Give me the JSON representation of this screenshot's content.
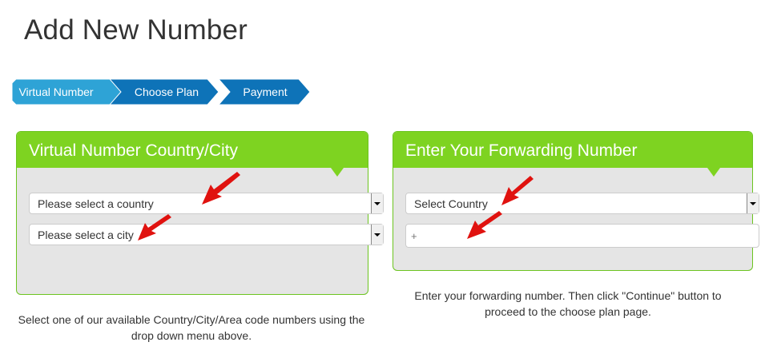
{
  "page": {
    "title": "Add New Number"
  },
  "steps": [
    {
      "label": "Virtual Number",
      "color": "#2ea3d6"
    },
    {
      "label": "Choose Plan",
      "color": "#0e73b8"
    },
    {
      "label": "Payment",
      "color": "#0e73b8"
    }
  ],
  "panel_left": {
    "title": "Virtual Number Country/City",
    "country_select": {
      "value": "Please select a country"
    },
    "city_select": {
      "value": "Please select a city"
    },
    "help": "Select one of our available Country/City/Area code numbers using the drop down menu above."
  },
  "panel_right": {
    "title": "Enter Your Forwarding Number",
    "country_select": {
      "value": "Select Country"
    },
    "number_input": {
      "placeholder": "+"
    },
    "help": "Enter your forwarding number. Then click \"Continue\" button to proceed to the choose plan page."
  },
  "colors": {
    "panel_header": "#7ed321",
    "panel_body": "#e5e5e5",
    "step_active": "#2ea3d6",
    "step_inactive": "#0e73b8",
    "annotation_arrow": "#e0120f"
  },
  "icons": {
    "select_arrow": "triangle-down-icon",
    "annotation": "red-arrow-icon"
  }
}
